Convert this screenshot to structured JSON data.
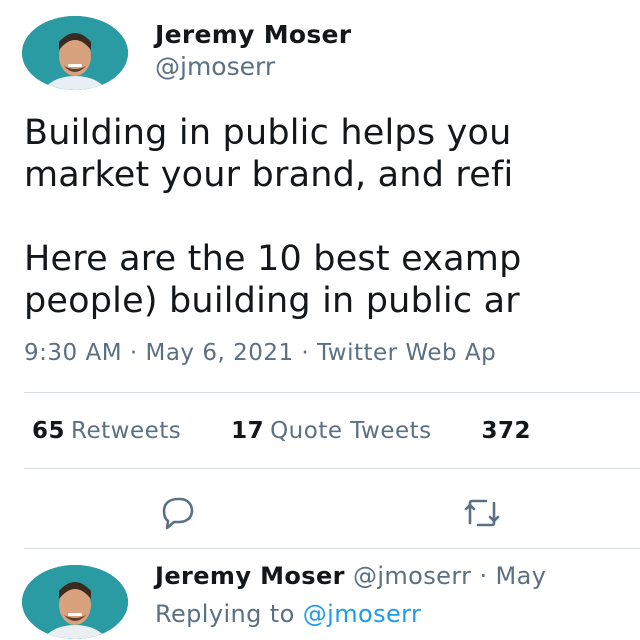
{
  "tweet": {
    "author_name": "Jeremy Moser",
    "author_handle": "@jmoserr",
    "text_lines": [
      "Building in public helps you",
      "market your brand, and refi",
      "Here are the 10 best examp",
      "people) building in public ar"
    ],
    "timestamp": "9:30 AM · May 6, 2021 · Twitter Web Ap",
    "stats": [
      {
        "count": "65",
        "label": "Retweets"
      },
      {
        "count": "17",
        "label": "Quote Tweets"
      },
      {
        "count": "372",
        "label": ""
      }
    ],
    "icons": [
      "reply-icon",
      "retweet-icon"
    ],
    "colors": {
      "text": "#14171a",
      "muted": "#5b7083",
      "link": "#1d9bf0",
      "avatar_bg": "#2a9aa3"
    }
  },
  "reply": {
    "author_name": "Jeremy Moser",
    "meta": "@jmoserr · May",
    "replying_prefix": "Replying to",
    "replying_handle": "@jmoserr"
  }
}
